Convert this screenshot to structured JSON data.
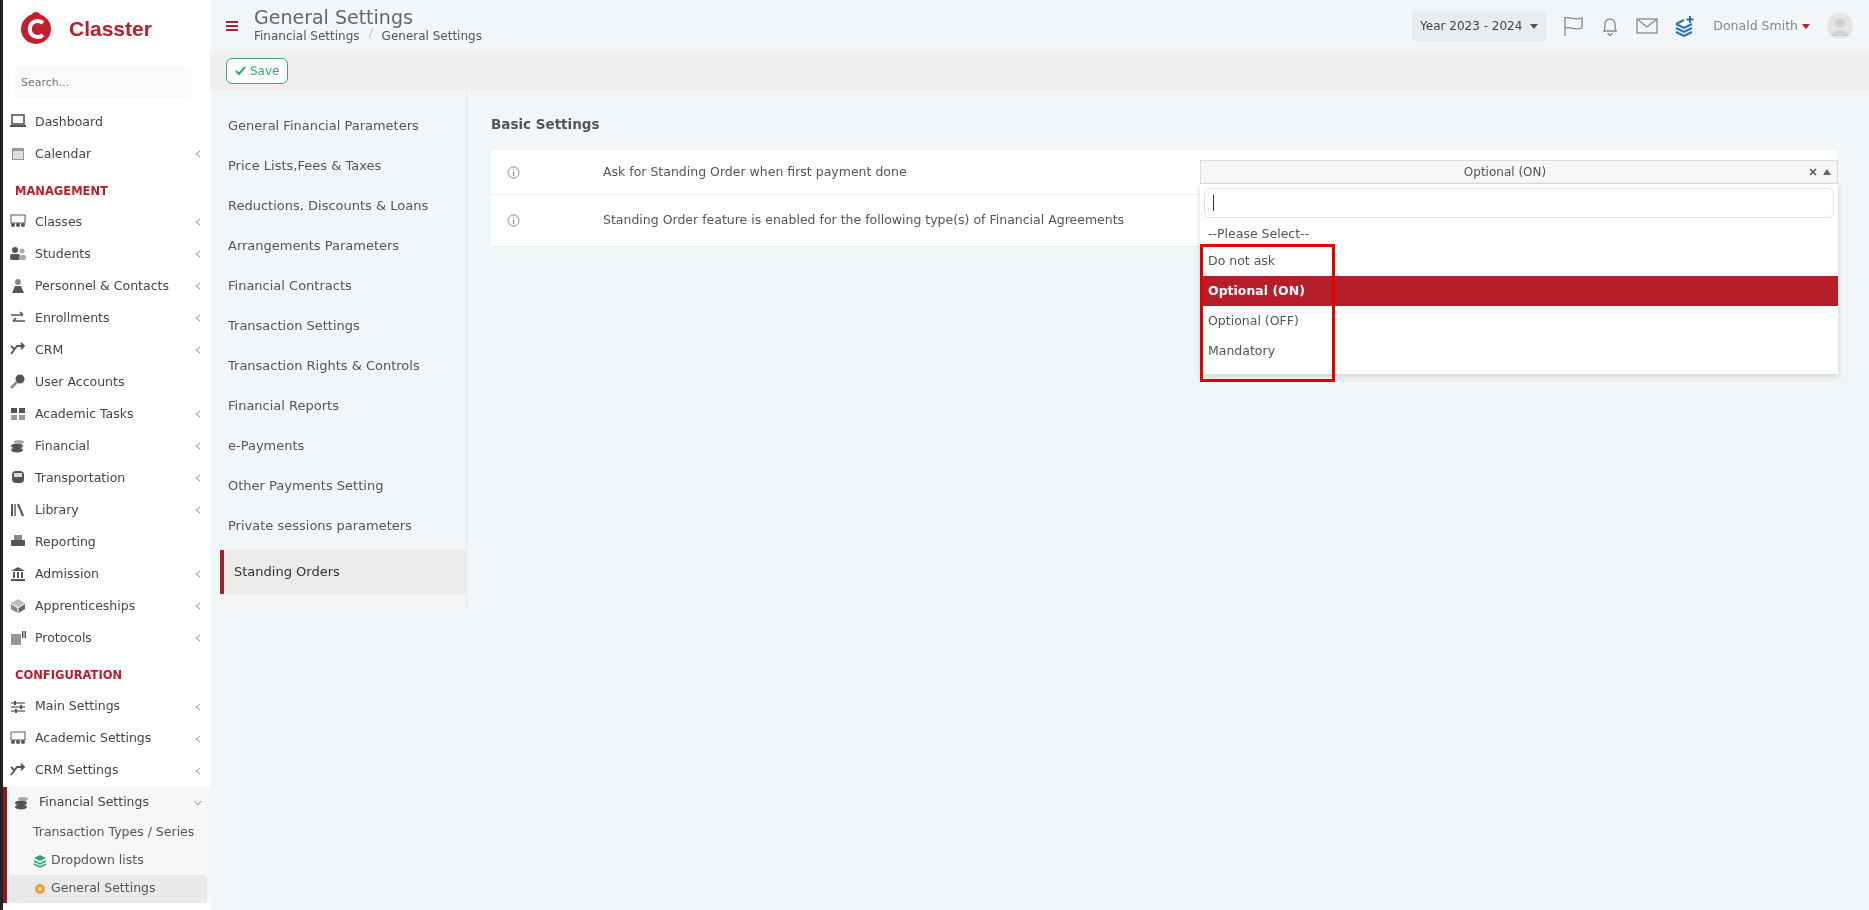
{
  "brand": {
    "name": "Classter"
  },
  "sidebar": {
    "search": {
      "placeholder": "Search..."
    },
    "items": [
      {
        "kind": "item",
        "label": "Dashboard",
        "submenu": false,
        "expanded": false
      },
      {
        "kind": "item",
        "label": "Calendar",
        "submenu": true,
        "expanded": false
      },
      {
        "kind": "heading",
        "label": "MANAGEMENT"
      },
      {
        "kind": "item",
        "label": "Classes",
        "submenu": true,
        "expanded": false
      },
      {
        "kind": "item",
        "label": "Students",
        "submenu": true,
        "expanded": false
      },
      {
        "kind": "item",
        "label": "Personnel & Contacts",
        "submenu": true,
        "expanded": false
      },
      {
        "kind": "item",
        "label": "Enrollments",
        "submenu": true,
        "expanded": false
      },
      {
        "kind": "item",
        "label": "CRM",
        "submenu": true,
        "expanded": false
      },
      {
        "kind": "item",
        "label": "User Accounts",
        "submenu": false,
        "expanded": false
      },
      {
        "kind": "item",
        "label": "Academic Tasks",
        "submenu": true,
        "expanded": false
      },
      {
        "kind": "item",
        "label": "Financial",
        "submenu": true,
        "expanded": false
      },
      {
        "kind": "item",
        "label": "Transportation",
        "submenu": true,
        "expanded": false
      },
      {
        "kind": "item",
        "label": "Library",
        "submenu": true,
        "expanded": false
      },
      {
        "kind": "item",
        "label": "Reporting",
        "submenu": false,
        "expanded": false
      },
      {
        "kind": "item",
        "label": "Admission",
        "submenu": true,
        "expanded": false
      },
      {
        "kind": "item",
        "label": "Apprenticeships",
        "submenu": true,
        "expanded": false
      },
      {
        "kind": "item",
        "label": "Protocols",
        "submenu": true,
        "expanded": false
      },
      {
        "kind": "heading",
        "label": "CONFIGURATION"
      },
      {
        "kind": "item",
        "label": "Main Settings",
        "submenu": true,
        "expanded": false
      },
      {
        "kind": "item",
        "label": "Academic Settings",
        "submenu": true,
        "expanded": false
      },
      {
        "kind": "item",
        "label": "CRM Settings",
        "submenu": true,
        "expanded": false
      },
      {
        "kind": "item",
        "label": "Financial Settings",
        "submenu": true,
        "expanded": true,
        "children": [
          {
            "label": "Transaction Types / Series",
            "selected": false
          },
          {
            "label": "Dropdown lists",
            "selected": false
          },
          {
            "label": "General Settings",
            "selected": true
          }
        ]
      }
    ]
  },
  "header": {
    "title": "General Settings",
    "breadcrumb": [
      "Financial Settings",
      "General Settings"
    ],
    "year": "Year 2023 - 2024",
    "user": "Donald Smith"
  },
  "toolbar": {
    "save": "Save"
  },
  "settings_menu": [
    {
      "label": "General Financial Parameters",
      "selected": false
    },
    {
      "label": "Price Lists,Fees & Taxes",
      "selected": false
    },
    {
      "label": "Reductions, Discounts & Loans",
      "selected": false
    },
    {
      "label": "Arrangements Parameters",
      "selected": false
    },
    {
      "label": "Financial Contracts",
      "selected": false
    },
    {
      "label": "Transaction Settings",
      "selected": false
    },
    {
      "label": "Transaction Rights & Controls",
      "selected": false
    },
    {
      "label": "Financial Reports",
      "selected": false
    },
    {
      "label": "e-Payments",
      "selected": false
    },
    {
      "label": "Other Payments Setting",
      "selected": false
    },
    {
      "label": "Private sessions parameters",
      "selected": false
    },
    {
      "label": "Standing Orders",
      "selected": true
    }
  ],
  "section": {
    "title": "Basic Settings",
    "rows": [
      {
        "label": "Ask for Standing Order when first payment done",
        "select": {
          "value": "Optional (ON)",
          "open": true,
          "options": [
            {
              "label": "--Please Select--",
              "selected": false
            },
            {
              "label": "Do not ask",
              "selected": false
            },
            {
              "label": "Optional (ON)",
              "selected": true
            },
            {
              "label": "Optional (OFF)",
              "selected": false
            },
            {
              "label": "Mandatory",
              "selected": false
            }
          ]
        }
      },
      {
        "label": "Standing Order feature is enabled for the following type(s) of Financial Agreements"
      }
    ]
  }
}
